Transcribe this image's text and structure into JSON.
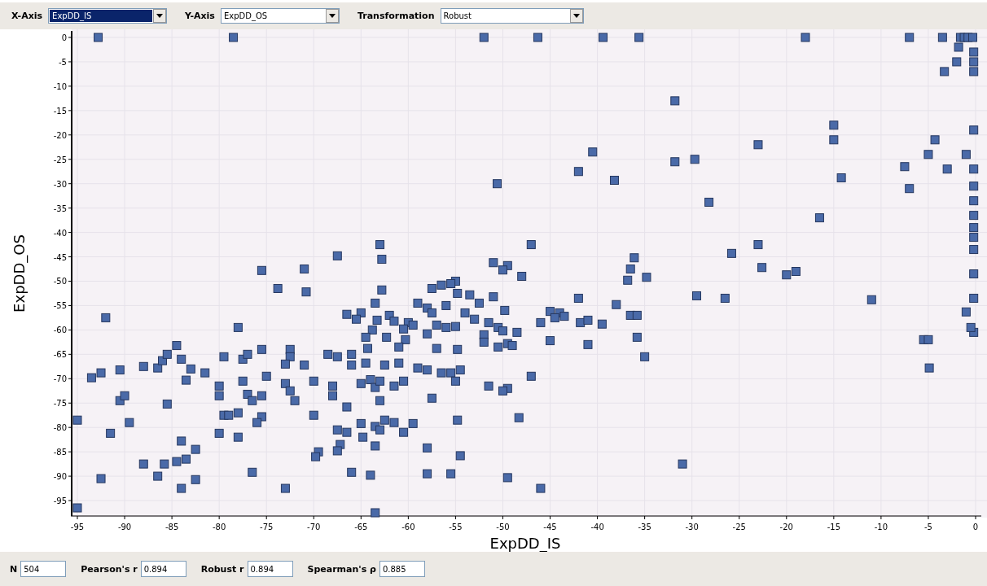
{
  "toolbar": {
    "selectors": [
      {
        "label": "X-Axis",
        "value": "ExpDD_IS",
        "selected": true
      },
      {
        "label": "Y-Axis",
        "value": "ExpDD_OS",
        "selected": false
      },
      {
        "label": "Transformation",
        "value": "Robust",
        "selected": false
      }
    ]
  },
  "chart": {
    "chart_data": {
      "type": "scatter",
      "xlabel": "ExpDD_IS",
      "ylabel": "ExpDD_OS",
      "xlim": [
        -95,
        0
      ],
      "ylim": [
        -98,
        0
      ],
      "grid": true,
      "xticks": [
        -95,
        -90,
        -85,
        -80,
        -75,
        -70,
        -65,
        -60,
        -55,
        -50,
        -45,
        -40,
        -35,
        -30,
        -25,
        -20,
        -15,
        -10,
        -5,
        0
      ],
      "yticks": [
        0,
        -5,
        -10,
        -15,
        -20,
        -25,
        -30,
        -35,
        -40,
        -45,
        -50,
        -55,
        -60,
        -65,
        -70,
        -75,
        -80,
        -85,
        -90,
        -95
      ],
      "x": [
        -92.8,
        -78.5,
        -52,
        -46.3,
        -39.4,
        -35.6,
        -18,
        -7,
        -3.5,
        -1.6,
        -1.2,
        -0.8,
        -0.3,
        -0.2,
        -0.2,
        -0.2,
        -0.2,
        -0.2,
        -0.2,
        -0.2,
        -0.2,
        -0.2,
        -0.2,
        -0.2,
        -0.2,
        -0.2,
        -0.2,
        -1.8,
        -2,
        -3.3,
        -31.8,
        -15,
        -15,
        -4.3,
        -40.5,
        -23,
        -5,
        -1,
        -42,
        -31.8,
        -29.7,
        -7.5,
        -3,
        -38.2,
        -14.2,
        -50.6,
        -7,
        -28.2,
        -16.5,
        -47,
        -63,
        -23,
        -25.8,
        -62.8,
        -36.1,
        -67.5,
        -75.5,
        -71,
        -36.5,
        -22.6,
        -51,
        -49.5,
        -19,
        -20,
        -50,
        -48,
        -34.8,
        -36.8,
        -73.8,
        -70.8,
        -62.8,
        -57.5,
        -55,
        -55.5,
        -56.5,
        -54.8,
        -53.5,
        -51,
        -42,
        -26.5,
        -29.5,
        -11,
        -59,
        -58,
        -56,
        -52.5,
        -38,
        -63.5,
        -65,
        -62,
        -60,
        -57.5,
        -54,
        -49.8,
        -45,
        -44,
        -43.5,
        -36.5,
        -35.8,
        -1,
        -66.5,
        -65.5,
        -63.3,
        -61.5,
        -59.5,
        -56,
        -55,
        -53,
        -51.5,
        -46,
        -44.5,
        -41.8,
        -41,
        -39.5,
        -78,
        -92,
        -63.8,
        -60.5,
        -58,
        -57,
        -52,
        -50.5,
        -50,
        -48.5,
        -35.8,
        -5.5,
        -5,
        -0.5,
        -64.5,
        -62.3,
        -60.3,
        -52,
        -49.5,
        -45,
        -41,
        -84.5,
        -75.5,
        -66,
        -64.3,
        -61,
        -57,
        -54.8,
        -50.5,
        -49,
        -35,
        -92.5,
        -93.5,
        -90.5,
        -88,
        -86.5,
        -86,
        -85.5,
        -84,
        -83,
        -81.5,
        -79.5,
        -77.5,
        -77,
        -72.5,
        -72.5,
        -71,
        -73,
        -68.5,
        -67.5,
        -66,
        -64.5,
        -62.5,
        -61,
        -59,
        -58,
        -56.5,
        -55.5,
        -54.5,
        -47,
        -75,
        -77.5,
        -83.5,
        -90.5,
        -90,
        -80,
        -77,
        -76.5,
        -75.5,
        -73,
        -72.5,
        -72,
        -70,
        -68,
        -68,
        -65,
        -64,
        -63.5,
        -63,
        -61.5,
        -60.5,
        -55,
        -51.5,
        -49.5,
        -50,
        -57.5,
        -63,
        -80,
        -85.5,
        -95,
        -89.5,
        -91.5,
        -79.5,
        -79,
        -78,
        -75.5,
        -76,
        -70,
        -66.5,
        -65,
        -63.5,
        -62.5,
        -61.5,
        -59.5,
        -54.8,
        -48.3,
        -80,
        -78,
        -67.5,
        -66.5,
        -64.8,
        -63,
        -60.5,
        -84,
        -82.5,
        -69.5,
        -69.8,
        -67.2,
        -67.5,
        -63.5,
        -58,
        -54.5,
        -88,
        -86.5,
        -85.8,
        -84.5,
        -83.5,
        -82.5,
        -84,
        -92.5,
        -76.5,
        -73,
        -66,
        -64,
        -58,
        -55.5,
        -49.5,
        -46,
        -31,
        -95,
        -63.5,
        -4.9
      ],
      "series": [
        {
          "color": "#4a6aa8",
          "values": [
            0,
            0,
            0,
            0,
            0,
            0,
            0,
            0,
            0,
            0,
            0,
            0,
            0,
            -3,
            -5,
            -7,
            -19,
            -27,
            -30.5,
            -33.5,
            -36.5,
            -39,
            -41,
            -43.5,
            -48.5,
            -53.5,
            -60.5,
            -2,
            -5,
            -7,
            -13,
            -18,
            -21,
            -21,
            -23.5,
            -22,
            -24,
            -24,
            -27.5,
            -25.5,
            -25,
            -26.5,
            -27,
            -29.3,
            -28.8,
            -30,
            -31,
            -33.8,
            -37,
            -42.5,
            -42.5,
            -42.5,
            -44.3,
            -45.5,
            -45.2,
            -44.8,
            -47.8,
            -47.5,
            -47.5,
            -47.2,
            -46.2,
            -46.8,
            -48,
            -48.7,
            -47.7,
            -49,
            -49.2,
            -49.8,
            -51.5,
            -52.2,
            -51.8,
            -51.5,
            -50,
            -50.5,
            -50.8,
            -52.5,
            -52.8,
            -53.2,
            -53.5,
            -53.5,
            -53,
            -53.8,
            -54.5,
            -55.5,
            -55,
            -54.5,
            -54.8,
            -54.5,
            -56.5,
            -57,
            -58.5,
            -56.5,
            -56.5,
            -56,
            -56.2,
            -56.5,
            -57.2,
            -57,
            -57,
            -56.3,
            -56.8,
            -57.8,
            -58,
            -58.2,
            -59,
            -59.5,
            -59.3,
            -57.8,
            -58.5,
            -58.5,
            -57.5,
            -58.5,
            -58,
            -58.8,
            -59.5,
            -57.5,
            -60,
            -59.8,
            -60.8,
            -59,
            -61,
            -59.5,
            -60.2,
            -60.5,
            -61.5,
            -62,
            -62,
            -59.5,
            -61.5,
            -61.5,
            -62,
            -62.5,
            -62.8,
            -62.2,
            -63,
            -63.2,
            -64,
            -65,
            -63.8,
            -63.5,
            -63.8,
            -64,
            -63.5,
            -63.2,
            -65.5,
            -68.8,
            -69.8,
            -68.2,
            -67.5,
            -67.8,
            -66.3,
            -65,
            -66,
            -68,
            -68.8,
            -65.5,
            -66,
            -65,
            -64,
            -65.5,
            -67.2,
            -67,
            -65,
            -65.5,
            -67.2,
            -66.8,
            -67.2,
            -66.8,
            -67.8,
            -68.2,
            -68.8,
            -68.8,
            -68.2,
            -69.5,
            -69.5,
            -70.5,
            -70.3,
            -74.5,
            -73.5,
            -71.5,
            -73.2,
            -74.5,
            -73.5,
            -71,
            -72.5,
            -74.5,
            -70.5,
            -71.5,
            -73.5,
            -71,
            -70.2,
            -71.8,
            -70.5,
            -71.5,
            -70.5,
            -70.5,
            -71.5,
            -72,
            -72.5,
            -74,
            -74.5,
            -73.5,
            -75.2,
            -78.5,
            -79,
            -81.2,
            -77.5,
            -77.5,
            -77,
            -77.8,
            -79,
            -77.5,
            -75.8,
            -79.2,
            -79.8,
            -78.5,
            -79,
            -79.2,
            -78.5,
            -78,
            -81.2,
            -82,
            -80.5,
            -81,
            -82,
            -80.5,
            -81,
            -82.8,
            -84.5,
            -85,
            -86,
            -83.5,
            -84.8,
            -83.8,
            -84.2,
            -85.8,
            -87.5,
            -90,
            -87.5,
            -87,
            -86.5,
            -90.7,
            -92.5,
            -90.5,
            -89.2,
            -92.5,
            -89.2,
            -89.8,
            -89.5,
            -89.5,
            -90.3,
            -92.5,
            -87.5,
            -96.5,
            -97.5,
            -67.8
          ]
        }
      ]
    }
  },
  "stats": [
    {
      "label": "N",
      "value": "504"
    },
    {
      "label": "Pearson's r",
      "value": "0.894"
    },
    {
      "label": "Robust r",
      "value": "0.894"
    },
    {
      "label": "Spearman's ρ",
      "value": "0.885"
    }
  ]
}
